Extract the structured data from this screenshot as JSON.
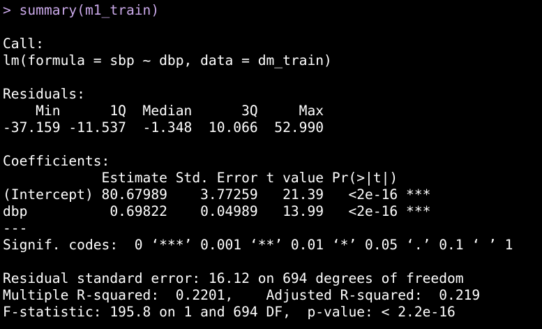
{
  "prompt_color": "#c9a8e8",
  "output_color": "#ffffff",
  "background": "#000000",
  "command": {
    "prompt": "> ",
    "text": "summary(m1_train)"
  },
  "call": {
    "header": "Call:",
    "formula": "lm(formula = sbp ~ dbp, data = dm_train)"
  },
  "residuals": {
    "header": "Residuals:",
    "labels_line": "    Min      1Q  Median      3Q     Max ",
    "values_line": "-37.159 -11.537  -1.348  10.066  52.990 ",
    "labels": [
      "Min",
      "1Q",
      "Median",
      "3Q",
      "Max"
    ],
    "values": [
      "-37.159",
      "-11.537",
      "-1.348",
      "10.066",
      "52.990"
    ]
  },
  "coefficients": {
    "header": "Coefficients:",
    "column_header_line": "            Estimate Std. Error t value Pr(>|t|)    ",
    "rows": [
      {
        "line": "(Intercept) 80.67989    3.77259   21.39   <2e-16 ***",
        "term": "(Intercept)",
        "estimate": "80.67989",
        "std_error": "3.77259",
        "t_value": "21.39",
        "p_value": "<2e-16",
        "signif": "***"
      },
      {
        "line": "dbp          0.69822    0.04989   13.99   <2e-16 ***",
        "term": "dbp",
        "estimate": "0.69822",
        "std_error": "0.04989",
        "t_value": "13.99",
        "p_value": "<2e-16",
        "signif": "***"
      }
    ],
    "separator": "---",
    "signif_codes": "Signif. codes:  0 ‘***’ 0.001 ‘**’ 0.01 ‘*’ 0.05 ‘.’ 0.1 ‘ ’ 1"
  },
  "fit": {
    "residual_se": "Residual standard error: 16.12 on 694 degrees of freedom",
    "r_squared": "Multiple R-squared:  0.2201,\tAdjusted R-squared:  0.219 ",
    "f_statistic": "F-statistic: 195.8 on 1 and 694 DF,  p-value: < 2.2e-16"
  }
}
